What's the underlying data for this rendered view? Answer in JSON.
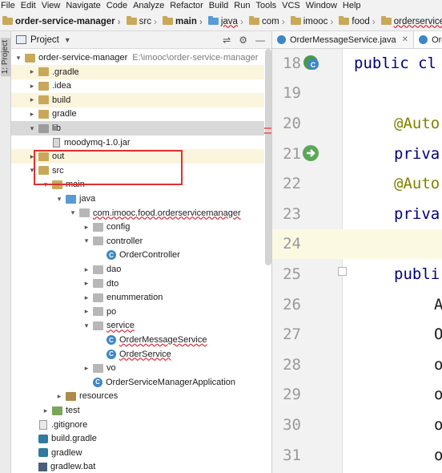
{
  "menu": [
    "File",
    "Edit",
    "View",
    "Navigate",
    "Code",
    "Analyze",
    "Refactor",
    "Build",
    "Run",
    "Tools",
    "VCS",
    "Window",
    "Help"
  ],
  "breadcrumb": [
    {
      "label": "order-service-manager",
      "icon": "folder-icon",
      "bold": true
    },
    {
      "label": "src",
      "icon": "folder-icon"
    },
    {
      "label": "main",
      "icon": "folder-icon",
      "bold": true
    },
    {
      "label": "java",
      "icon": "folder-icon",
      "wavy": true
    },
    {
      "label": "com",
      "icon": "folder-icon"
    },
    {
      "label": "imooc",
      "icon": "folder-icon"
    },
    {
      "label": "food",
      "icon": "folder-icon"
    },
    {
      "label": "orderservicemanag",
      "icon": "folder-icon",
      "wavy": true
    }
  ],
  "side_strip": {
    "label": "1: Project"
  },
  "project_panel": {
    "title": "Project",
    "tree": [
      {
        "label": "order-service-manager",
        "path": "E:\\imooc\\order-service-manager",
        "icon": "folder",
        "depth": 0,
        "expanded": true
      },
      {
        "label": ".gradle",
        "icon": "folder",
        "depth": 1,
        "expanded": false,
        "highlight": "yellow"
      },
      {
        "label": ".idea",
        "icon": "folder",
        "depth": 1,
        "expanded": false
      },
      {
        "label": "build",
        "icon": "folder",
        "depth": 1,
        "expanded": false,
        "highlight": "yellow"
      },
      {
        "label": "gradle",
        "icon": "folder",
        "depth": 1,
        "expanded": false
      },
      {
        "label": "lib",
        "icon": "folder-gray",
        "depth": 1,
        "expanded": true,
        "highlight": "gray"
      },
      {
        "label": "moodymq-1.0.jar",
        "icon": "jar",
        "depth": 2
      },
      {
        "label": "out",
        "icon": "folder",
        "depth": 1,
        "expanded": false,
        "highlight": "yellow"
      },
      {
        "label": "src",
        "icon": "folder",
        "depth": 1,
        "expanded": true
      },
      {
        "label": "main",
        "icon": "folder",
        "depth": 2,
        "expanded": true
      },
      {
        "label": "java",
        "icon": "folder-blue",
        "depth": 3,
        "expanded": true
      },
      {
        "label": "com.imooc.food.orderservicemanager",
        "icon": "package",
        "depth": 4,
        "expanded": true,
        "wavy": true
      },
      {
        "label": "config",
        "icon": "package",
        "depth": 5,
        "expanded": false
      },
      {
        "label": "controller",
        "icon": "package",
        "depth": 5,
        "expanded": true
      },
      {
        "label": "OrderController",
        "icon": "class",
        "depth": 6
      },
      {
        "label": "dao",
        "icon": "package",
        "depth": 5,
        "expanded": false
      },
      {
        "label": "dto",
        "icon": "package",
        "depth": 5,
        "expanded": false
      },
      {
        "label": "enummeration",
        "icon": "package",
        "depth": 5,
        "expanded": false
      },
      {
        "label": "po",
        "icon": "package",
        "depth": 5,
        "expanded": false
      },
      {
        "label": "service",
        "icon": "package",
        "depth": 5,
        "expanded": true,
        "wavy": true
      },
      {
        "label": "OrderMessageService",
        "icon": "class",
        "depth": 6,
        "wavy": true
      },
      {
        "label": "OrderService",
        "icon": "class",
        "depth": 6,
        "wavy": true
      },
      {
        "label": "vo",
        "icon": "package",
        "depth": 5,
        "expanded": false
      },
      {
        "label": "OrderServiceManagerApplication",
        "icon": "class",
        "depth": 5
      },
      {
        "label": "resources",
        "icon": "folder-brown",
        "depth": 3,
        "expanded": false
      },
      {
        "label": "test",
        "icon": "folder-green",
        "depth": 2,
        "expanded": false
      },
      {
        "label": ".gitignore",
        "icon": "file",
        "depth": 1
      },
      {
        "label": "build.gradle",
        "icon": "gradle",
        "depth": 1
      },
      {
        "label": "gradlew",
        "icon": "gradle",
        "depth": 1
      },
      {
        "label": "gradlew.bat",
        "icon": "bat",
        "depth": 1
      }
    ]
  },
  "editor": {
    "tabs": [
      {
        "label": "OrderMessageService.java",
        "active": false
      },
      {
        "label": "Orde",
        "active": true
      }
    ],
    "lines": [
      {
        "num": "18",
        "text": "public cl",
        "style": "kw",
        "gutter_icon": "class-icon"
      },
      {
        "num": "19",
        "text": ""
      },
      {
        "num": "20",
        "text": "@Auto",
        "style": "anno",
        "indent": 1
      },
      {
        "num": "21",
        "text": "priva",
        "style": "kw",
        "indent": 1,
        "gutter_icon": "bean-icon"
      },
      {
        "num": "22",
        "text": "@Auto",
        "style": "anno",
        "indent": 1
      },
      {
        "num": "23",
        "text": "priva",
        "style": "kw",
        "indent": 1
      },
      {
        "num": "24",
        "text": "",
        "current": true
      },
      {
        "num": "25",
        "text": "publi",
        "style": "kw",
        "indent": 1,
        "fold": true
      },
      {
        "num": "26",
        "text": "A",
        "indent": 2
      },
      {
        "num": "27",
        "text": "O",
        "indent": 2
      },
      {
        "num": "28",
        "text": "o",
        "indent": 2
      },
      {
        "num": "29",
        "text": "o",
        "indent": 2
      },
      {
        "num": "30",
        "text": "o",
        "indent": 2
      },
      {
        "num": "31",
        "text": "o",
        "indent": 2
      }
    ]
  },
  "colors": {
    "selection_box": "#e03030",
    "current_line": "#fcf9e3",
    "keyword": "#000080",
    "annotation": "#808000"
  }
}
